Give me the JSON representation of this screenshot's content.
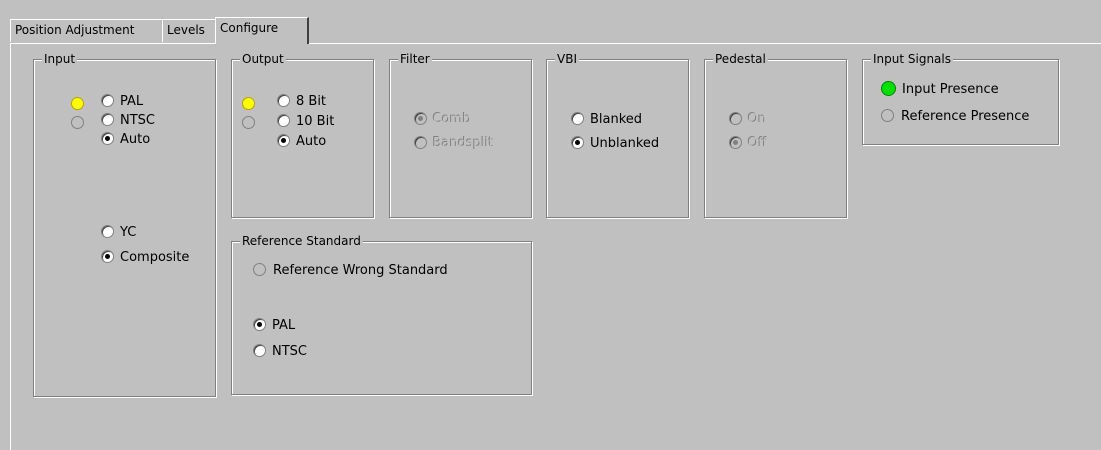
{
  "tabs": [
    "Position Adjustment",
    "Levels",
    "Configure"
  ],
  "input": {
    "title": "Input",
    "format_options": [
      "PAL",
      "NTSC",
      "Auto"
    ],
    "format_selected": "Auto",
    "type_options": [
      "YC",
      "Composite"
    ],
    "type_selected": "Composite",
    "leds": [
      "yellow",
      "off"
    ]
  },
  "output": {
    "title": "Output",
    "options": [
      "8 Bit",
      "10 Bit",
      "Auto"
    ],
    "selected": "Auto",
    "leds": [
      "yellow",
      "off"
    ]
  },
  "filter": {
    "title": "Filter",
    "options": [
      "Comb",
      "Bandsplit"
    ],
    "selected": "Comb",
    "disabled": true
  },
  "vbi": {
    "title": "VBI",
    "options": [
      "Blanked",
      "Unblanked"
    ],
    "selected": "Unblanked"
  },
  "pedestal": {
    "title": "Pedestal",
    "options": [
      "On",
      "Off"
    ],
    "selected": "Off",
    "disabled": true
  },
  "input_signals": {
    "title": "Input Signals",
    "items": [
      {
        "label": "Input Presence",
        "state": "green"
      },
      {
        "label": "Reference Presence",
        "state": "off"
      }
    ]
  },
  "reference_standard": {
    "title": "Reference Standard",
    "indicator_label": "Reference Wrong Standard",
    "options": [
      "PAL",
      "NTSC"
    ],
    "selected": "PAL"
  }
}
